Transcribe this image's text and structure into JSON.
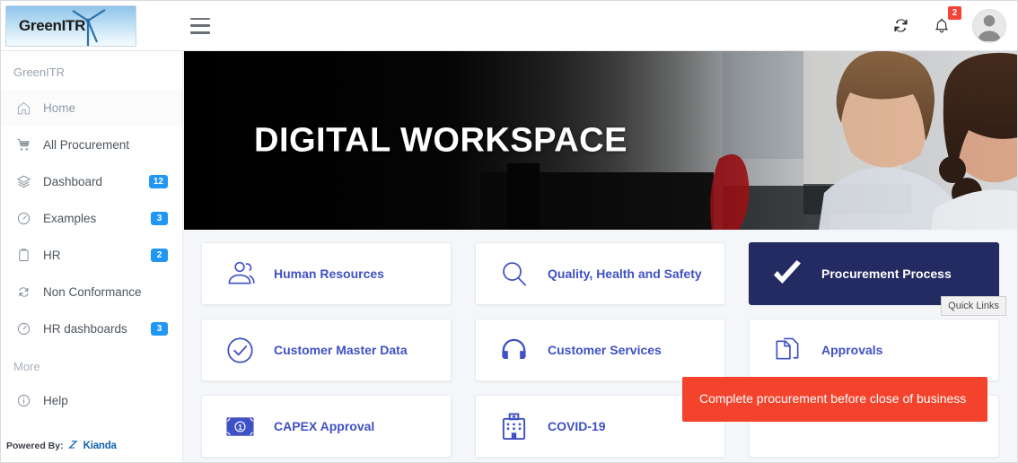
{
  "brand": {
    "logo_text": "GreenITR",
    "logo_icon": "wind-turbine-icon"
  },
  "topbar": {
    "menu_icon": "hamburger-menu-icon",
    "refresh_icon": "refresh-icon",
    "notifications_icon": "bell-icon",
    "notifications_count": "2",
    "avatar_icon": "user-avatar-icon"
  },
  "sidebar": {
    "title": "GreenITR",
    "items": [
      {
        "label": "Home",
        "icon": "home-icon",
        "badge": "",
        "active": true
      },
      {
        "label": "All Procurement",
        "icon": "cart-icon",
        "badge": "",
        "active": false
      },
      {
        "label": "Dashboard",
        "icon": "layers-icon",
        "badge": "12",
        "active": false
      },
      {
        "label": "Examples",
        "icon": "gauge-icon",
        "badge": "3",
        "active": false
      },
      {
        "label": "HR",
        "icon": "clipboard-icon",
        "badge": "2",
        "active": false
      },
      {
        "label": "Non Conformance",
        "icon": "sync-icon",
        "badge": "",
        "active": false
      },
      {
        "label": "HR dashboards",
        "icon": "gauge-icon",
        "badge": "3",
        "active": false
      }
    ],
    "section_label": "More",
    "more_items": [
      {
        "label": "Help",
        "icon": "info-circle-icon",
        "badge": "",
        "active": false
      }
    ],
    "footer": {
      "powered_by": "Powered By:",
      "vendor": "Kianda",
      "vendor_icon": "kianda-logo-icon"
    }
  },
  "hero": {
    "title": "DIGITAL WORKSPACE",
    "image_alt": "two-colleagues-at-desk-photo"
  },
  "tiles": [
    {
      "label": "Human Resources",
      "icon": "people-icon",
      "highlight": false
    },
    {
      "label": "Quality, Health and Safety",
      "icon": "magnifier-icon",
      "highlight": false
    },
    {
      "label": "Procurement Process",
      "icon": "check-icon",
      "highlight": true
    },
    {
      "label": "Customer Master Data",
      "icon": "check-circle-icon",
      "highlight": false
    },
    {
      "label": "Customer Services",
      "icon": "headset-icon",
      "highlight": false
    },
    {
      "label": "Approvals",
      "icon": "documents-copy-icon",
      "highlight": false
    },
    {
      "label": "CAPEX Approval",
      "icon": "banknote-icon",
      "highlight": false
    },
    {
      "label": "COVID-19",
      "icon": "hospital-icon",
      "highlight": false
    },
    {
      "label": "",
      "icon": "",
      "highlight": false
    }
  ],
  "tooltip": {
    "text": "Quick Links"
  },
  "toast": {
    "message": "Complete procurement before close of business"
  },
  "colors": {
    "accent_blue": "#3f51c4",
    "highlight_navy": "#242a62",
    "badge_blue": "#2196f3",
    "toast_red": "#f4432c",
    "notification_red": "#f44336",
    "page_bg": "#f4f6f9"
  }
}
